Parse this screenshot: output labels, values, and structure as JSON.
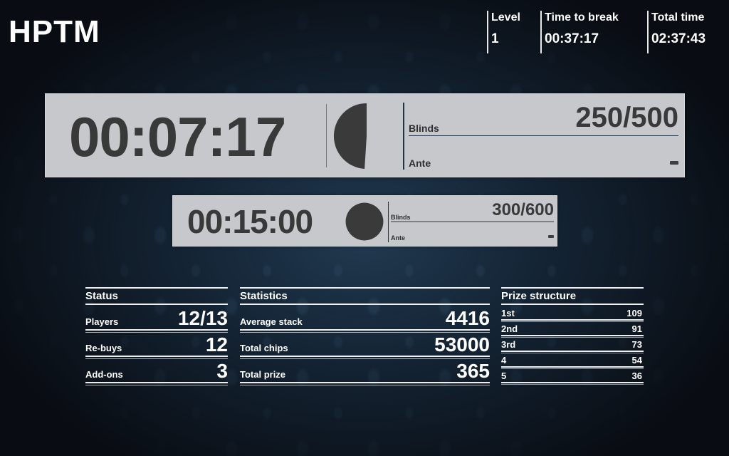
{
  "app": {
    "title": "HPTM"
  },
  "header_info": {
    "level": {
      "label": "Level",
      "value": "1"
    },
    "time_to_break": {
      "label": "Time to break",
      "value": "00:37:17"
    },
    "total_time": {
      "label": "Total time",
      "value": "02:37:43"
    }
  },
  "current_level": {
    "timer": "00:07:17",
    "clock_remaining_fraction": 0.49,
    "blinds_label": "Blinds",
    "blinds_value": "250/500",
    "ante_label": "Ante",
    "ante_value": "-"
  },
  "next_level": {
    "timer": "00:15:00",
    "clock_remaining_fraction": 1.0,
    "blinds_label": "Blinds",
    "blinds_value": "300/600",
    "ante_label": "Ante",
    "ante_value": "-"
  },
  "status": {
    "title": "Status",
    "rows": [
      {
        "label": "Players",
        "value": "12/13"
      },
      {
        "label": "Re-buys",
        "value": "12"
      },
      {
        "label": "Add-ons",
        "value": "3"
      }
    ]
  },
  "statistics": {
    "title": "Statistics",
    "rows": [
      {
        "label": "Average stack",
        "value": "4416"
      },
      {
        "label": "Total chips",
        "value": "53000"
      },
      {
        "label": "Total prize",
        "value": "365"
      }
    ]
  },
  "prize_structure": {
    "title": "Prize structure",
    "rows": [
      {
        "label": "1st",
        "value": "109"
      },
      {
        "label": "2nd",
        "value": "91"
      },
      {
        "label": "3rd",
        "value": "73"
      },
      {
        "label": "4",
        "value": "54"
      },
      {
        "label": "5",
        "value": "36"
      }
    ]
  },
  "colors": {
    "panel_bg": "#c6c8cb",
    "panel_text": "#393939",
    "clock_fill": "#3a3a3a",
    "divider_accent": "#243446"
  }
}
